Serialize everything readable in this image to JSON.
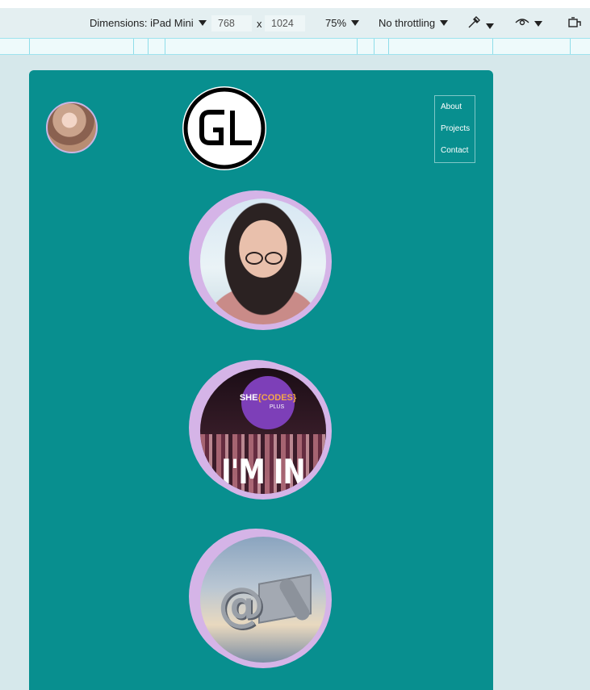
{
  "devtools": {
    "dimensions_label": "Dimensions: iPad Mini",
    "width": "768",
    "times": "x",
    "height": "1024",
    "zoom": "75%",
    "throttling": "No throttling"
  },
  "nav": {
    "items": [
      {
        "label": "About"
      },
      {
        "label": "Projects"
      },
      {
        "label": "Contact"
      }
    ]
  },
  "cards": [
    {
      "badge_top": "SHE",
      "badge_mid": "{CODES}",
      "badge_plus": "PLUS",
      "caption": "I'M IN"
    }
  ],
  "colors": {
    "page_bg": "#088f8f",
    "ring": "#d5b4e7"
  }
}
